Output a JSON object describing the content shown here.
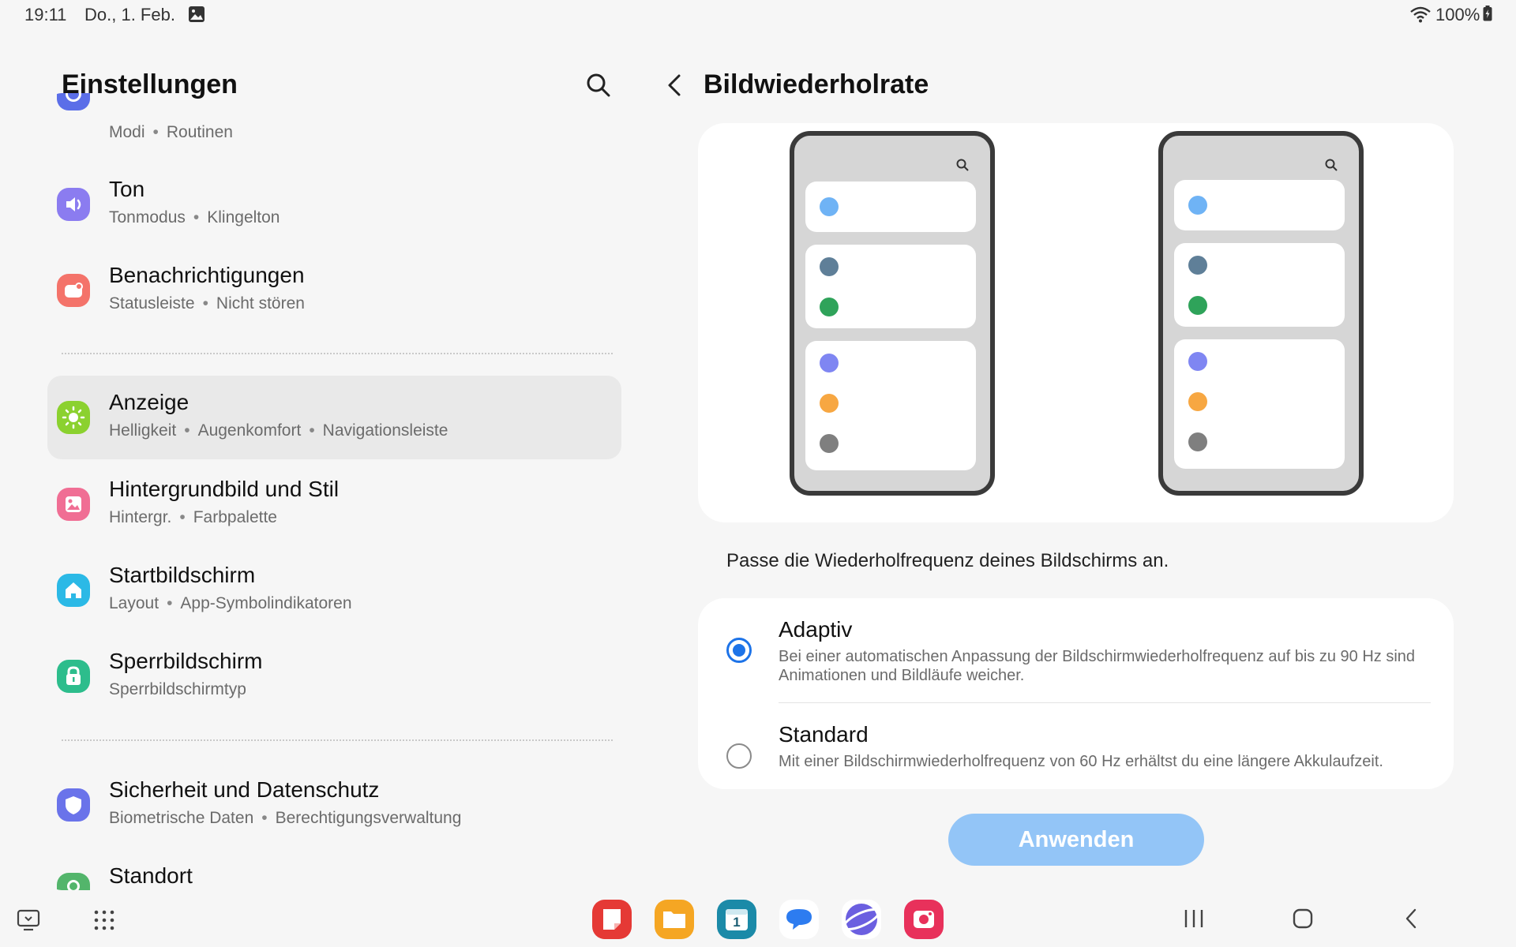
{
  "status_bar": {
    "time": "19:11",
    "date": "Do., 1. Feb.",
    "battery": "100%"
  },
  "left_panel": {
    "title": "Einstellungen",
    "items": [
      {
        "id": "modi",
        "title": "",
        "subs": [
          "Modi",
          "Routinen"
        ],
        "color": "#5b6ee8"
      },
      {
        "id": "ton",
        "title": "Ton",
        "subs": [
          "Tonmodus",
          "Klingelton"
        ],
        "color": "#8b7cf0"
      },
      {
        "id": "benachrichtigungen",
        "title": "Benachrichtigungen",
        "subs": [
          "Statusleiste",
          "Nicht stören"
        ],
        "color": "#f4736a"
      },
      {
        "id": "anzeige",
        "title": "Anzeige",
        "subs": [
          "Helligkeit",
          "Augenkomfort",
          "Navigationsleiste"
        ],
        "color": "#8bd12f"
      },
      {
        "id": "hintergrund",
        "title": "Hintergrundbild und Stil",
        "subs": [
          "Hintergr.",
          "Farbpalette"
        ],
        "color": "#f06e94"
      },
      {
        "id": "startbildschirm",
        "title": "Startbildschirm",
        "subs": [
          "Layout",
          "App-Symbolindikatoren"
        ],
        "color": "#2bb9e6"
      },
      {
        "id": "sperrbildschirm",
        "title": "Sperrbildschirm",
        "subs": [
          "Sperrbildschirmtyp"
        ],
        "color": "#2dbd8c"
      },
      {
        "id": "sicherheit",
        "title": "Sicherheit und Datenschutz",
        "subs": [
          "Biometrische Daten",
          "Berechtigungsverwaltung"
        ],
        "color": "#6a73ea"
      },
      {
        "id": "standort",
        "title": "Standort",
        "subs": [],
        "color": "#53b56b"
      }
    ]
  },
  "right_panel": {
    "title": "Bildwiederholrate",
    "description": "Passe die Wiederholfrequenz deines Bildschirms an.",
    "options": [
      {
        "title": "Adaptiv",
        "desc": "Bei einer automatischen Anpassung der Bildschirmwiederholfrequenz auf bis zu 90 Hz sind Animationen und Bildläufe weicher.",
        "selected": true
      },
      {
        "title": "Standard",
        "desc": "Mit einer Bildschirmwiederholfrequenz von 60 Hz erhältst du eine längere Akkulaufzeit.",
        "selected": false
      }
    ],
    "apply_label": "Anwenden"
  },
  "preview": {
    "dot_colors": [
      "#6fb3f5",
      "#5f7f98",
      "#2fa35a",
      "#7f86f2",
      "#f7a742",
      "#7f7f7f"
    ]
  },
  "dock": [
    {
      "name": "notes",
      "color": "#e53935"
    },
    {
      "name": "my-files",
      "color": "#f5a623"
    },
    {
      "name": "calendar",
      "color": "#1b8aa8"
    },
    {
      "name": "messages",
      "color": "#2d7cf0"
    },
    {
      "name": "internet",
      "color": "#6b5fe0"
    },
    {
      "name": "screen-recorder",
      "color": "#e8315b"
    }
  ],
  "calendar_day": "1"
}
